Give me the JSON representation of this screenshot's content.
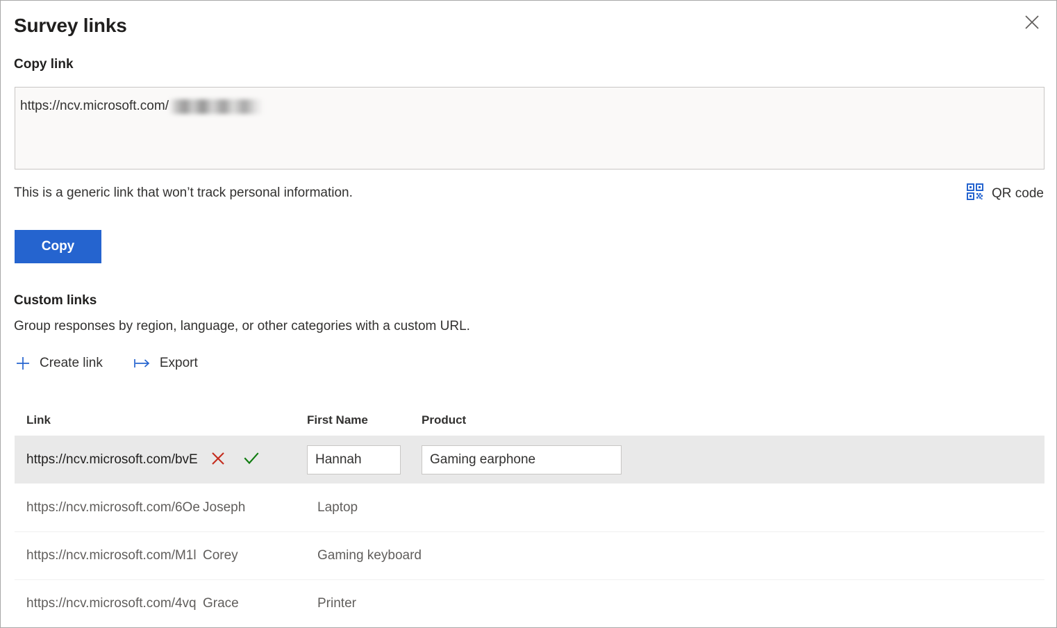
{
  "panel": {
    "title": "Survey links",
    "close_icon": "close-icon"
  },
  "copy_link": {
    "label": "Copy link",
    "url_prefix": "https://ncv.microsoft.com/",
    "url_token_redacted": true,
    "note": "This is a generic link that won’t track personal information.",
    "copy_button": "Copy"
  },
  "qr": {
    "label": "QR code",
    "icon": "qr-code-icon",
    "color": "#2564cf"
  },
  "custom_links": {
    "title": "Custom links",
    "description": "Group responses by region, language, or other categories with a custom URL.",
    "commands": [
      {
        "label": "Create link",
        "icon": "plus-icon"
      },
      {
        "label": "Export",
        "icon": "export-icon"
      }
    ],
    "columns": [
      "Link",
      "First Name",
      "Product"
    ],
    "rows": [
      {
        "link": "https://ncv.microsoft.com/bvE",
        "first_name": "Hannah",
        "product": "Gaming earphone",
        "selected": true,
        "editing": true,
        "actions": [
          {
            "name": "cancel-edit",
            "icon": "x-icon",
            "color": "#c42b1c"
          },
          {
            "name": "confirm-edit",
            "icon": "check-icon",
            "color": "#107c10"
          }
        ]
      },
      {
        "link": "https://ncv.microsoft.com/6Oe",
        "first_name": "Joseph",
        "product": "Laptop",
        "selected": false,
        "editing": false
      },
      {
        "link": "https://ncv.microsoft.com/M1l",
        "first_name": "Corey",
        "product": "Gaming keyboard",
        "selected": false,
        "editing": false
      },
      {
        "link": "https://ncv.microsoft.com/4vq",
        "first_name": "Grace",
        "product": "Printer",
        "selected": false,
        "editing": false
      }
    ]
  },
  "colors": {
    "accent": "#2564cf",
    "selected_row": "#e9e9e9",
    "input_bg": "#faf9f8",
    "border": "#c8c6c4",
    "text": "#323130",
    "danger": "#c42b1c",
    "success": "#107c10"
  }
}
